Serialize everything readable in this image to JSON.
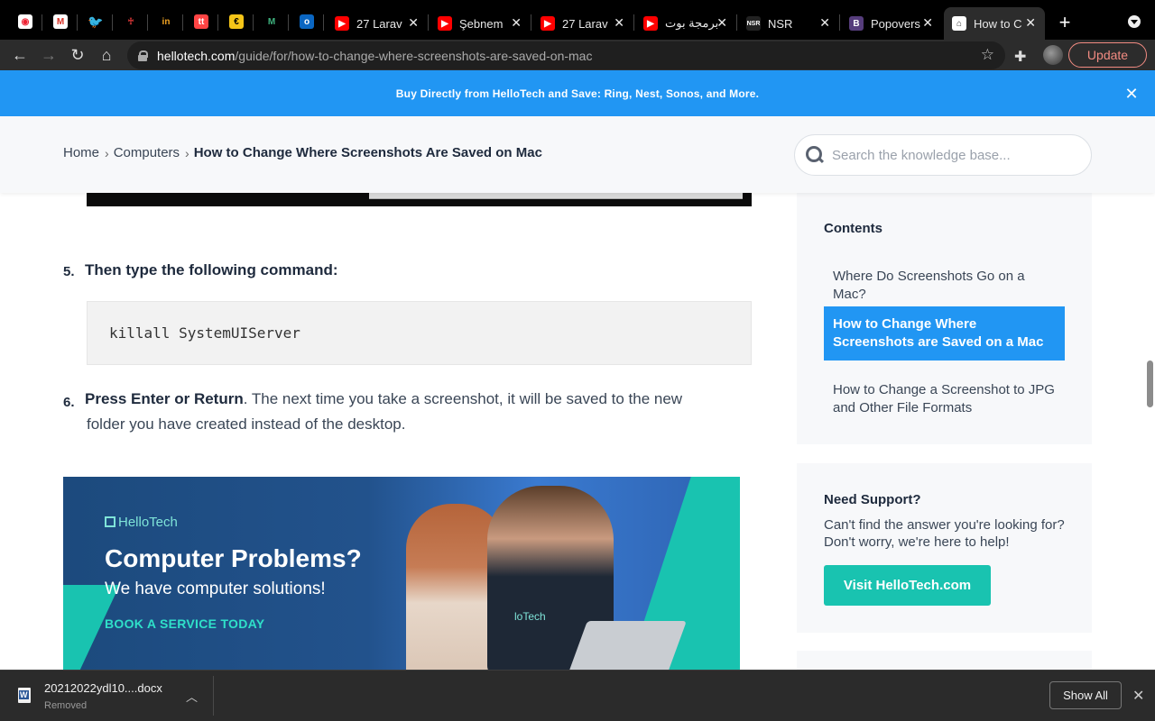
{
  "browser": {
    "tabs": [
      {
        "title": "27 Larav",
        "favicon": "youtube-icon",
        "color": "#ff0000"
      },
      {
        "title": "Şebnem",
        "favicon": "youtube-icon",
        "color": "#ff0000"
      },
      {
        "title": "27 Larav",
        "favicon": "youtube-icon",
        "color": "#ff0000"
      },
      {
        "title": "برمجة بوت",
        "favicon": "youtube-icon",
        "color": "#ff0000"
      },
      {
        "title": "NSR",
        "favicon": "nsr-icon",
        "color": "#333333"
      },
      {
        "title": "Popovers",
        "favicon": "bootstrap-icon",
        "color": "#563d7c"
      },
      {
        "title": "How to C",
        "favicon": "hellotech-icon",
        "color": "#ffffff"
      }
    ],
    "url_host": "hellotech.com",
    "url_path": "/guide/for/how-to-change-where-screenshots-are-saved-on-mac",
    "update_label": "Update"
  },
  "promo": {
    "text": "Buy Directly from HelloTech and Save: Ring, Nest, Sonos, and More."
  },
  "header": {
    "breadcrumbs": [
      "Home",
      "Computers",
      "How to Change Where Screenshots Are Saved on Mac"
    ],
    "search_placeholder": "Search the knowledge base..."
  },
  "article": {
    "step5_num": "5.",
    "step5_text": "Then type the following command:",
    "code": "killall SystemUIServer",
    "step6_num": "6.",
    "step6_bold": "Press Enter or Return",
    "step6_text": ". The next time you take a screenshot, it will be saved to the new",
    "step6_cont": "folder you have created instead of the desktop."
  },
  "ad": {
    "logo": "HelloTech",
    "headline": "Computer Problems?",
    "subline": "We have computer solutions!",
    "cta": "BOOK A SERVICE TODAY",
    "shirt_text": "loTech"
  },
  "sidebar": {
    "contents_title": "Contents",
    "toc": [
      {
        "label": "Where Do Screenshots Go on a Mac?",
        "active": false
      },
      {
        "label": "How to Change Where Screenshots are Saved on a Mac",
        "active": true
      },
      {
        "label": "How to Change a Screenshot to JPG and Other File Formats",
        "active": false
      }
    ],
    "support_title": "Need Support?",
    "support_text": "Can't find the answer you're looking for? Don't worry, we're here to help!",
    "support_button": "Visit HelloTech.com"
  },
  "downloads": {
    "filename": "20212022ydl10....docx",
    "status": "Removed",
    "show_all": "Show All"
  },
  "colors": {
    "accent": "#2196f3",
    "teal": "#19c3b0",
    "text_dark": "#1e2a3d"
  }
}
